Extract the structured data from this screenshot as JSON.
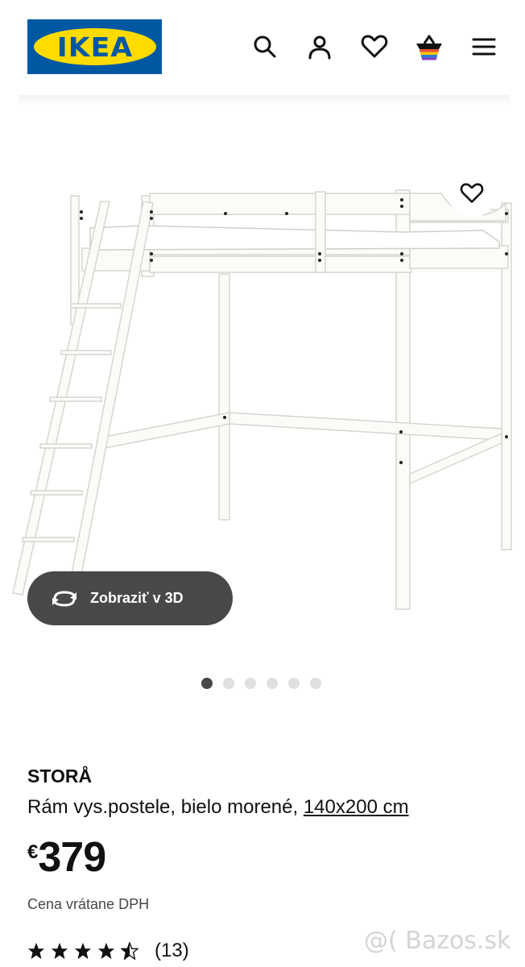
{
  "header": {
    "logo_text": "IKEA",
    "icons": [
      "search-icon",
      "account-icon",
      "favorites-icon",
      "cart-icon",
      "menu-icon"
    ]
  },
  "gallery": {
    "favorite_icon": "heart-icon",
    "view_3d_label": "Zobraziť v 3D",
    "view_3d_icon": "rotate-icon",
    "slide_count": 6,
    "active_slide": 1
  },
  "product": {
    "name": "STORÅ",
    "description": "Rám vys.postele, bielo morené, ",
    "size": "140x200 cm",
    "currency": "€",
    "price": "379",
    "vat_note": "Cena vrátane DPH",
    "rating_value": 4.5,
    "rating_max": 5,
    "rating_count": "(13)"
  },
  "watermark": "@( Bazos.sk",
  "colors": {
    "ikea_blue": "#0058a3",
    "ikea_yellow": "#ffdb00",
    "dark_button": "#484848"
  }
}
